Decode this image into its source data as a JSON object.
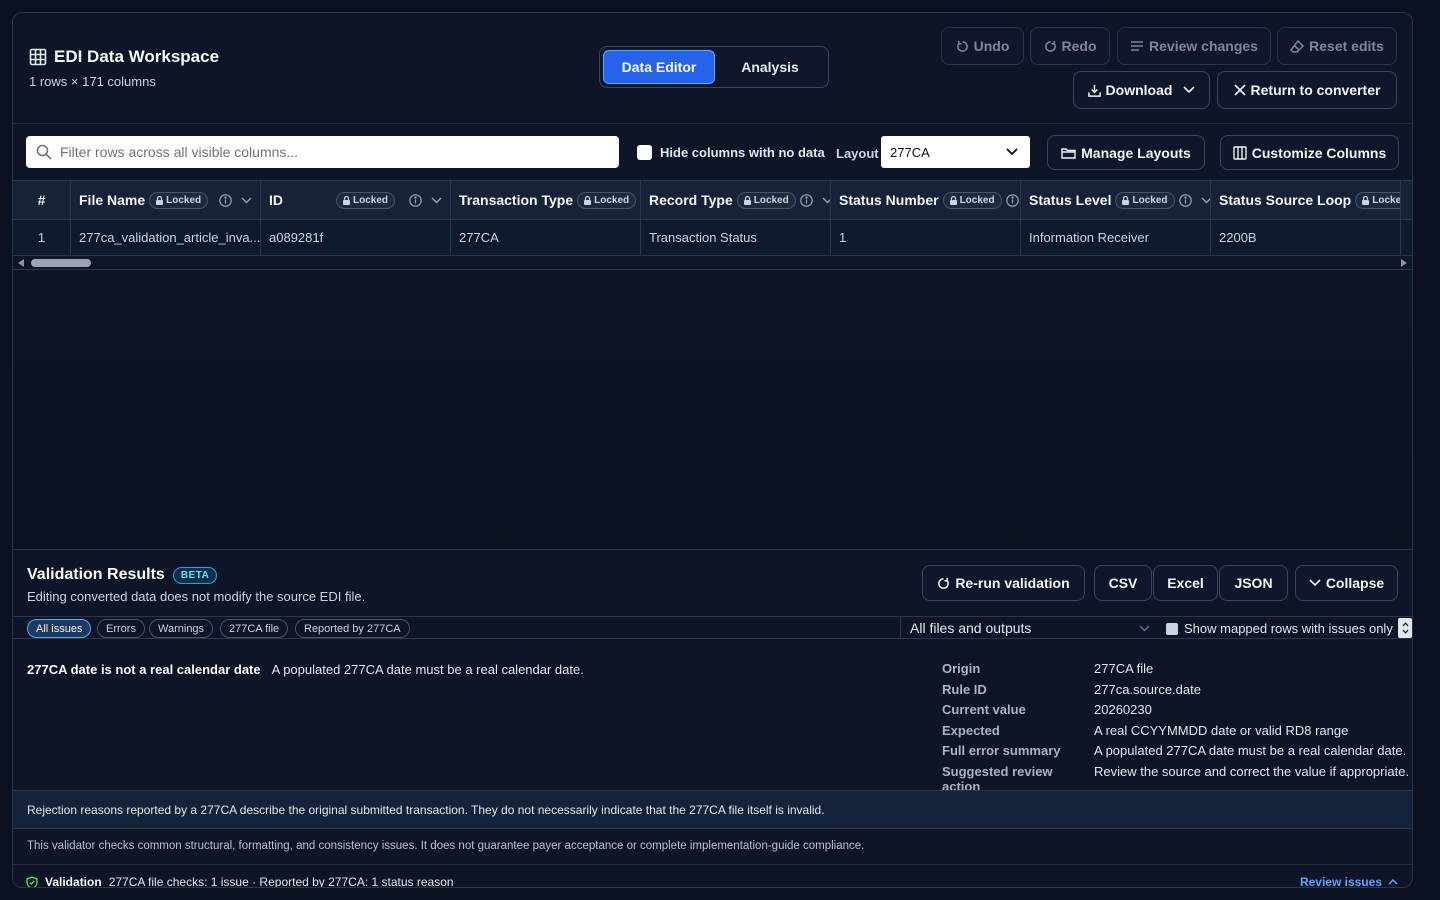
{
  "header": {
    "title": "EDI Data Workspace",
    "subtitle": "1 rows × 171 columns",
    "tabs": [
      {
        "label": "Data Editor",
        "active": true
      },
      {
        "label": "Analysis",
        "active": false
      }
    ],
    "undo_label": "Undo",
    "redo_label": "Redo",
    "review_label": "Review changes",
    "reset_label": "Reset edits",
    "download_label": "Download",
    "return_label": "Return to converter"
  },
  "toolbar": {
    "filter_placeholder": "Filter rows across all visible columns...",
    "hide_empty_label": "Hide columns with no data",
    "layout_label": "Layout",
    "layout_value": "277CA",
    "manage_layouts_label": "Manage Layouts",
    "customize_columns_label": "Customize Columns"
  },
  "grid": {
    "row_num_header": "#",
    "locked_label": "Locked",
    "columns": [
      "File Name",
      "ID",
      "Transaction Type",
      "Record Type",
      "Status Number",
      "Status Level",
      "Status Source Loop"
    ],
    "rows": [
      {
        "num": "1",
        "cells": [
          "277ca_validation_article_inva...",
          "a089281f",
          "277CA",
          "Transaction Status",
          "1",
          "Information Receiver",
          "2200B"
        ]
      }
    ]
  },
  "validation": {
    "title": "Validation Results",
    "badge": "BETA",
    "subtitle": "Editing converted data does not modify the source EDI file.",
    "rerun_label": "Re-run validation",
    "csv_label": "CSV",
    "excel_label": "Excel",
    "json_label": "JSON",
    "collapse_label": "Collapse",
    "filters": [
      "All issues",
      "Errors",
      "Warnings",
      "277CA file",
      "Reported by 277CA"
    ],
    "scope_value": "All files and outputs",
    "mapped_only_label": "Show mapped rows with issues only",
    "issue": {
      "title": "277CA date is not a real calendar date",
      "description": "A populated 277CA date must be a real calendar date.",
      "details": [
        {
          "key": "Origin",
          "value": "277CA file"
        },
        {
          "key": "Rule ID",
          "value": "277ca.source.date"
        },
        {
          "key": "Current value",
          "value": "20260230"
        },
        {
          "key": "Expected",
          "value": "A real CCYYMMDD date or valid RD8 range"
        },
        {
          "key": "Full error summary",
          "value": "A populated 277CA date must be a real calendar date."
        },
        {
          "key": "Suggested review action",
          "value": "Review the source and correct the value if appropriate."
        }
      ]
    },
    "note_rejection": "Rejection reasons reported by a 277CA describe the original submitted transaction. They do not necessarily indicate that the 277CA file itself is invalid.",
    "note_scope": "This validator checks common structural, formatting, and consistency issues. It does not guarantee payer acceptance or complete implementation-guide compliance.",
    "footer_label": "Validation",
    "footer_summary": "277CA file checks: 1 issue · Reported by 277CA: 1 status reason",
    "review_issues_label": "Review issues"
  },
  "colors": {
    "accent": "#2563eb",
    "link": "#60a5fa",
    "background": "#0b1120"
  }
}
